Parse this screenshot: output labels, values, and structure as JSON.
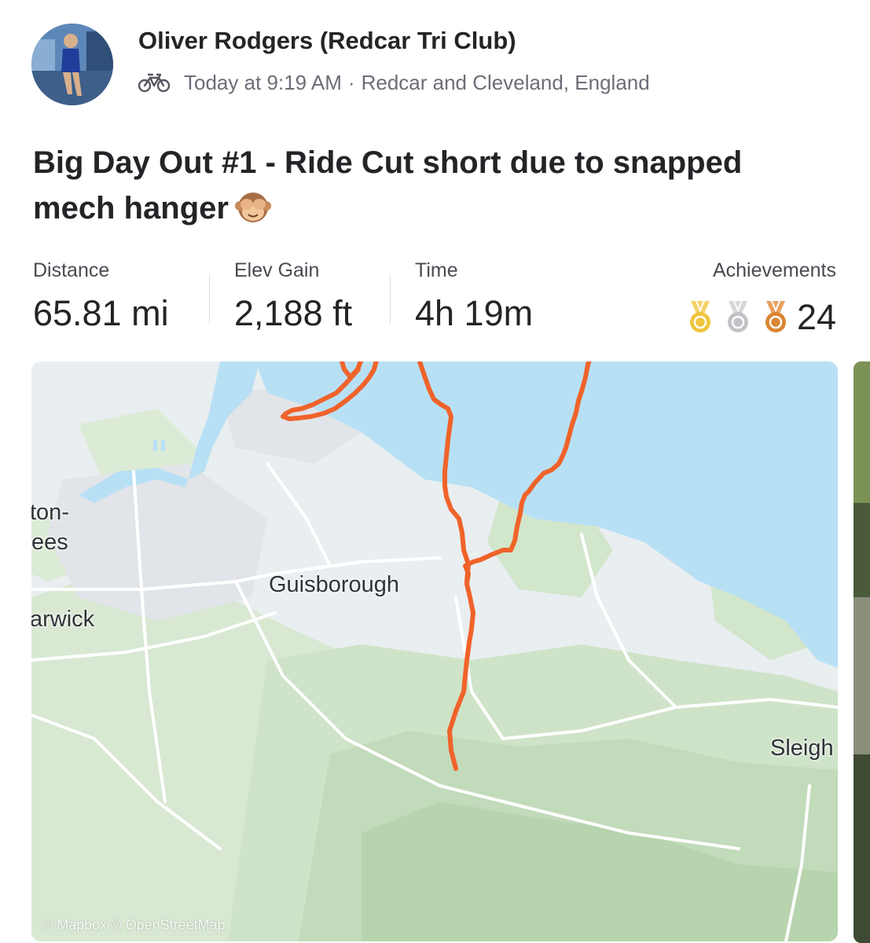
{
  "athlete": {
    "name": "Oliver Rodgers (Redcar Tri Club)",
    "activity_icon": "bike-icon",
    "timestamp": "Today at 9:19 AM",
    "separator": "·",
    "location": "Redcar and Cleveland, England"
  },
  "activity": {
    "title": "Big Day Out #1 - Ride Cut short due to snapped mech hanger",
    "emoji": "see-no-evil-monkey-icon"
  },
  "stats": {
    "distance": {
      "label": "Distance",
      "value": "65.81 mi"
    },
    "elev_gain": {
      "label": "Elev Gain",
      "value": "2,188 ft"
    },
    "time": {
      "label": "Time",
      "value": "4h 19m"
    },
    "achievements": {
      "label": "Achievements",
      "count": "24",
      "medals": [
        "gold-medal-icon",
        "silver-medal-icon",
        "bronze-medal-icon"
      ]
    }
  },
  "map": {
    "place_labels": [
      "ton-",
      "ees",
      "Guisborough",
      "arwick",
      "Sleigh"
    ],
    "attribution": "© Mapbox © OpenStreetMap",
    "route_color": "#f0632a",
    "sea_color": "#b8e0f5",
    "land_color": "#e9eef0"
  }
}
